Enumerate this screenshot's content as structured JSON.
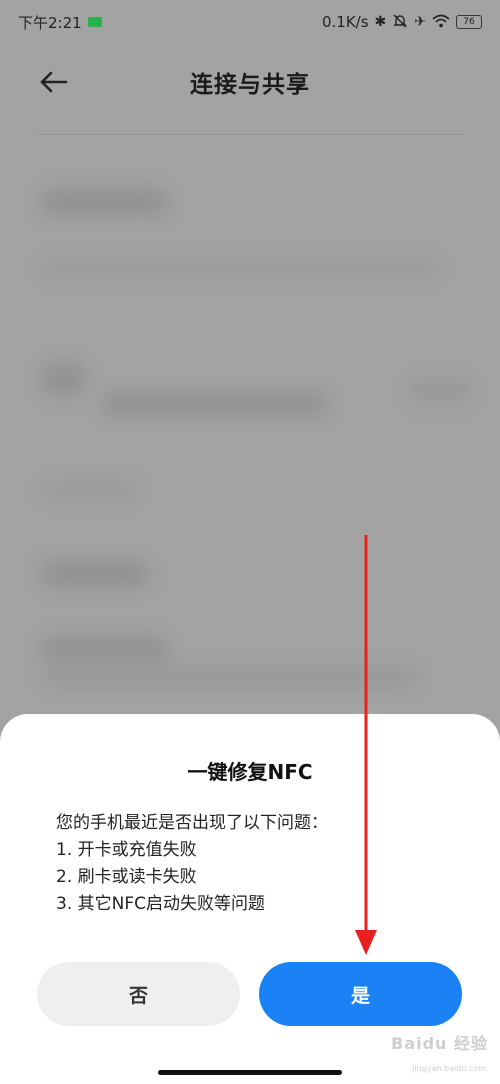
{
  "status_bar": {
    "time": "下午2:21",
    "network_speed": "0.1K/s",
    "battery_level": "76",
    "icons": [
      "bluetooth-icon",
      "mute-icon",
      "airplane-icon",
      "wifi-icon",
      "battery-icon"
    ]
  },
  "header": {
    "back_icon": "back-arrow-icon",
    "title": "连接与共享"
  },
  "dialog": {
    "title": "一键修复NFC",
    "body": [
      "您的手机最近是否出现了以下问题：",
      "1. 开卡或充值失败",
      "2. 刷卡或读卡失败",
      "3. 其它NFC启动失败等问题"
    ],
    "no_label": "否",
    "yes_label": "是"
  },
  "watermark": {
    "text": "Baidu 经验",
    "sub": "jingyan.baidu.com"
  },
  "colors": {
    "accent": "#1a82f4",
    "annotation_arrow": "#e8201e",
    "dim_background": "#a3a3a3"
  }
}
